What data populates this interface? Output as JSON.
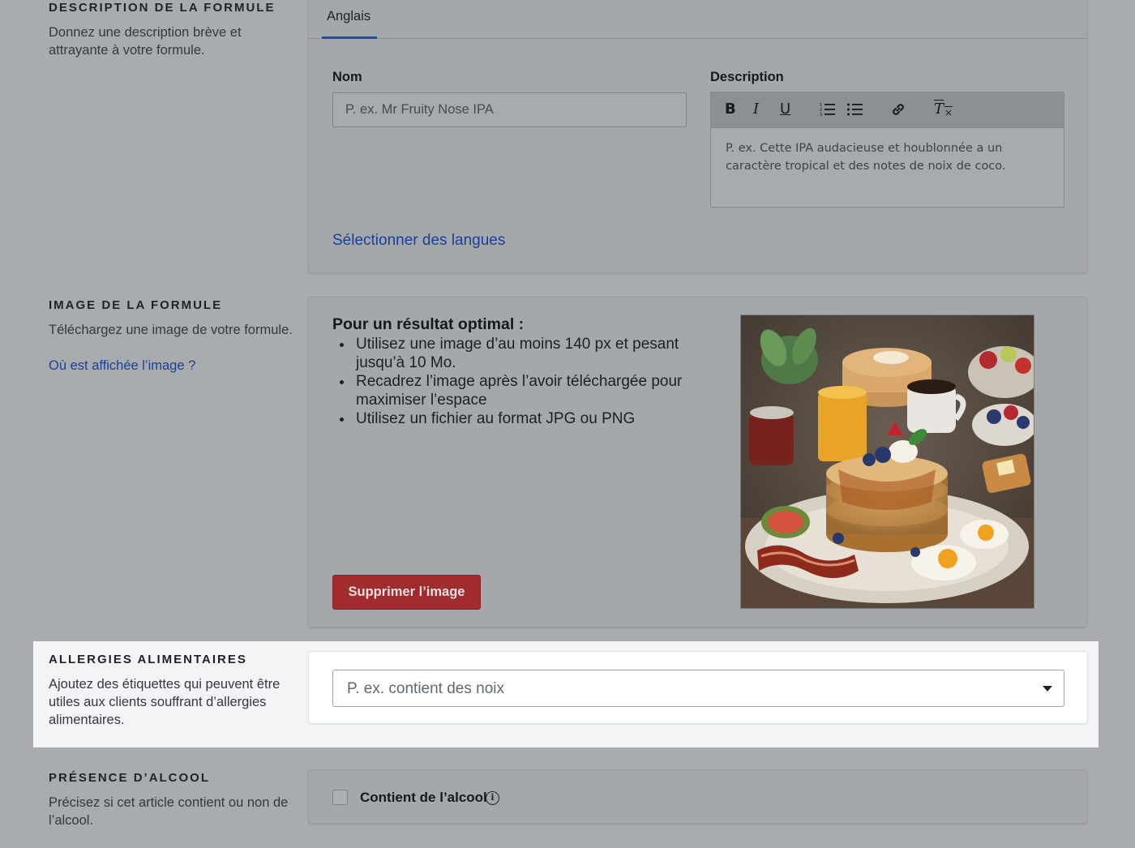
{
  "description_section": {
    "title": "DESCRIPTION DE LA FORMULE",
    "desc": "Donnez une description brève et attrayante à votre formule.",
    "tab": "Anglais",
    "name_label": "Nom",
    "name_placeholder": "P. ex. Mr Fruity Nose IPA",
    "description_label": "Description",
    "toolbar": {
      "bold": "B",
      "italic": "I",
      "underline": "U",
      "clear_format": "T"
    },
    "description_placeholder": "P. ex. Cette IPA audacieuse et houblonnée a un caractère tropical et des notes de noix de coco.",
    "languages_link": "Sélectionner des langues"
  },
  "image_section": {
    "title": "IMAGE DE LA FORMULE",
    "desc": "Téléchargez une image de votre formule.",
    "where_link": "Où est affichée l’image ?",
    "tips_title": "Pour un résultat optimal :",
    "tips": [
      "Utilisez une image d’au moins 140 px et pesant jusqu’à 10 Mo.",
      "Recadrez l’image après l’avoir téléchargée pour maximiser l’espace",
      "Utilisez un fichier au format JPG ou PNG"
    ],
    "delete_button": "Supprimer l’image",
    "photo_icon": "breakfast-photo"
  },
  "allergy_section": {
    "title": "ALLERGIES ALIMENTAIRES",
    "desc": "Ajoutez des étiquettes qui peuvent être utiles aux clients souffrant d’allergies alimentaires.",
    "select_placeholder": "P. ex. contient des noix"
  },
  "alcohol_section": {
    "title": "PRÉSENCE D’ALCOOL",
    "desc": "Précisez si cet article contient ou non de l’alcool.",
    "checkbox_label": "Contient de l’alcool",
    "info_glyph": "i"
  }
}
